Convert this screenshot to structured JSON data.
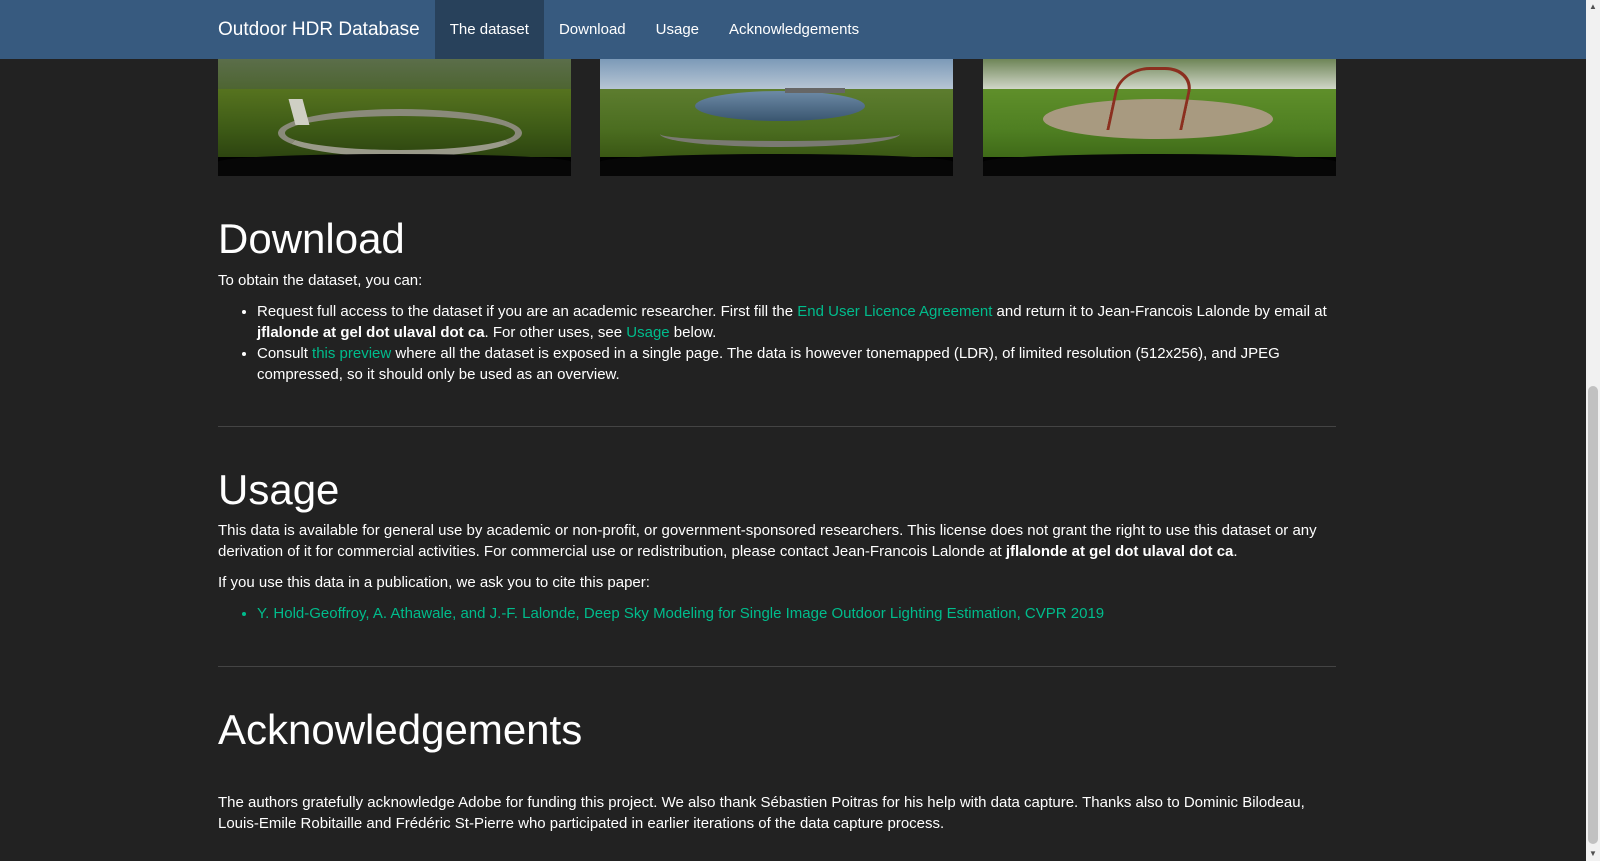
{
  "nav": {
    "brand": "Outdoor HDR Database",
    "links": [
      "The dataset",
      "Download",
      "Usage",
      "Acknowledgements"
    ]
  },
  "download": {
    "title": "Download",
    "intro": "To obtain the dataset, you can:",
    "item1": {
      "before": "Request full access to the dataset if you are an academic researcher. First fill the ",
      "link": "End User Licence Agreement",
      "middle": " and return it to Jean-Francois Lalonde by email at ",
      "email": "jflalonde at gel dot ulaval dot ca",
      "after": ". For other uses, see ",
      "usage_link": "Usage",
      "end": " below."
    },
    "item2": {
      "before": "Consult ",
      "link": "this preview",
      "after": " where all the dataset is exposed in a single page. The data is however tonemapped (LDR), of limited resolution (512x256), and JPEG compressed, so it should only be used as an overview."
    }
  },
  "usage": {
    "title": "Usage",
    "para1_before": "This data is available for general use by academic or non-profit, or government-sponsored researchers. This license does not grant the right to use this dataset or any derivation of it for commercial activities. For commercial use or redistribution, please contact Jean-Francois Lalonde at ",
    "para1_email": "jflalonde at gel dot ulaval dot ca",
    "para1_after": ".",
    "cite_intro": "If you use this data in a publication, we ask you to cite this paper:",
    "citation": "Y. Hold-Geoffroy, A. Athawale, and J.-F. Lalonde, Deep Sky Modeling for Single Image Outdoor Lighting Estimation, CVPR 2019"
  },
  "ack": {
    "title": "Acknowledgements",
    "text": "The authors gratefully acknowledge Adobe for funding this project. We also thank Sébastien Poitras for his help with data capture. Thanks also to Dominic Bilodeau, Louis-Emile Robitaille and Frédéric St-Pierre who participated in earlier iterations of the data capture process."
  },
  "colors": {
    "navbar": "#375a7f",
    "nav_active": "#28415b",
    "background": "#222222",
    "link": "#00bc8c",
    "text": "#ffffff"
  },
  "icons": [
    "chevron-up-icon",
    "chevron-down-icon"
  ]
}
